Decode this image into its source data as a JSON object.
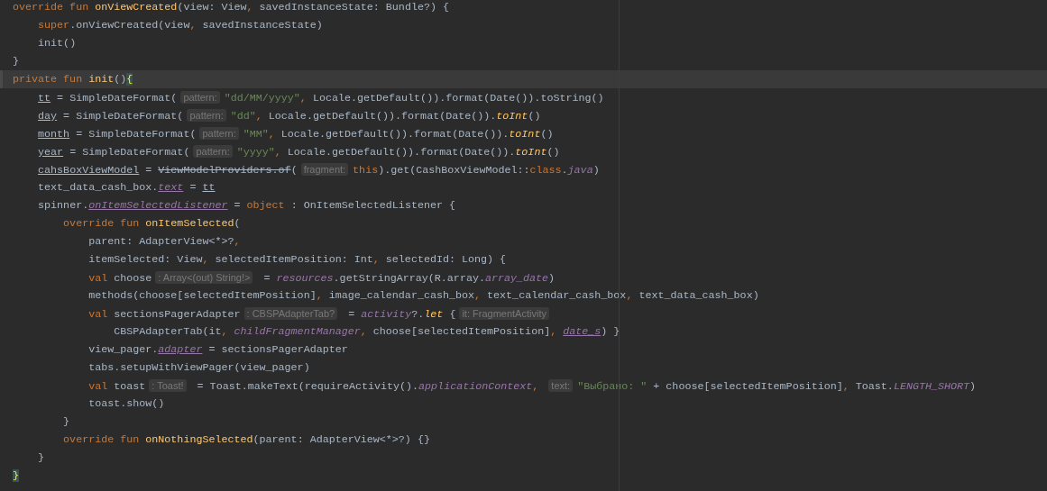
{
  "editor": {
    "lines": [
      {
        "current": false,
        "tokens": [
          {
            "kind": "kw",
            "text": "override fun "
          },
          {
            "kind": "fn",
            "text": "onViewCreated"
          },
          {
            "kind": "plain",
            "text": "(view: View"
          },
          {
            "kind": "op",
            "text": ", "
          },
          {
            "kind": "plain",
            "text": "savedInstanceState: Bundle?) {"
          }
        ]
      },
      {
        "current": false,
        "tokens": [
          {
            "kind": "kw",
            "text": "    super"
          },
          {
            "kind": "plain",
            "text": ".onViewCreated(view"
          },
          {
            "kind": "op",
            "text": ", "
          },
          {
            "kind": "plain",
            "text": "savedInstanceState)"
          }
        ]
      },
      {
        "current": false,
        "tokens": [
          {
            "kind": "plain",
            "text": "    init()"
          }
        ]
      },
      {
        "current": false,
        "tokens": [
          {
            "kind": "plain",
            "text": "}"
          }
        ]
      },
      {
        "current": true,
        "tokens": [
          {
            "kind": "kw",
            "text": "private fun "
          },
          {
            "kind": "fn",
            "text": "init"
          },
          {
            "kind": "plain",
            "text": "()"
          },
          {
            "kind": "match",
            "text": "{"
          }
        ]
      },
      {
        "current": false,
        "tokens": [
          {
            "kind": "var",
            "text": "    tt"
          },
          {
            "kind": "plain",
            "text": " = SimpleDateFormat("
          },
          {
            "kind": "hint",
            "text": "pattern:"
          },
          {
            "kind": "str",
            "text": "\"dd/MM/yyyy\""
          },
          {
            "kind": "op",
            "text": ", "
          },
          {
            "kind": "plain",
            "text": "Locale.getDefault()).format(Date()).toString()"
          }
        ]
      },
      {
        "current": false,
        "tokens": [
          {
            "kind": "var",
            "text": "    day"
          },
          {
            "kind": "plain",
            "text": " = SimpleDateFormat("
          },
          {
            "kind": "hint",
            "text": "pattern:"
          },
          {
            "kind": "str",
            "text": "\"dd\""
          },
          {
            "kind": "op",
            "text": ", "
          },
          {
            "kind": "plain",
            "text": "Locale.getDefault()).format(Date())."
          },
          {
            "kind": "ext",
            "text": "toInt"
          },
          {
            "kind": "plain",
            "text": "()"
          }
        ]
      },
      {
        "current": false,
        "tokens": [
          {
            "kind": "var",
            "text": "    month"
          },
          {
            "kind": "plain",
            "text": " = SimpleDateFormat("
          },
          {
            "kind": "hint",
            "text": "pattern:"
          },
          {
            "kind": "str",
            "text": "\"MM\""
          },
          {
            "kind": "op",
            "text": ", "
          },
          {
            "kind": "plain",
            "text": "Locale.getDefault()).format(Date())."
          },
          {
            "kind": "ext",
            "text": "toInt"
          },
          {
            "kind": "plain",
            "text": "()"
          }
        ]
      },
      {
        "current": false,
        "tokens": [
          {
            "kind": "var",
            "text": "    year"
          },
          {
            "kind": "plain",
            "text": " = SimpleDateFormat("
          },
          {
            "kind": "hint",
            "text": "pattern:"
          },
          {
            "kind": "str",
            "text": "\"yyyy\""
          },
          {
            "kind": "op",
            "text": ", "
          },
          {
            "kind": "plain",
            "text": "Locale.getDefault()).format(Date())."
          },
          {
            "kind": "ext",
            "text": "toInt"
          },
          {
            "kind": "plain",
            "text": "()"
          }
        ]
      },
      {
        "current": false,
        "tokens": [
          {
            "kind": "var",
            "text": "    cahsBoxViewModel"
          },
          {
            "kind": "plain",
            "text": " = "
          },
          {
            "kind": "deprecated",
            "text": "ViewModelProviders.of"
          },
          {
            "kind": "plain",
            "text": "("
          },
          {
            "kind": "hint",
            "text": "fragment:"
          },
          {
            "kind": "kw",
            "text": "this"
          },
          {
            "kind": "plain",
            "text": ").get(CashBoxViewModel::"
          },
          {
            "kind": "kw",
            "text": "class"
          },
          {
            "kind": "plain",
            "text": "."
          },
          {
            "kind": "const",
            "text": "java"
          },
          {
            "kind": "plain",
            "text": ")"
          }
        ]
      },
      {
        "current": false,
        "tokens": [
          {
            "kind": "plain",
            "text": "    text_data_cash_box."
          },
          {
            "kind": "field",
            "text": "text"
          },
          {
            "kind": "plain",
            "text": " = "
          },
          {
            "kind": "var",
            "text": "tt"
          }
        ]
      },
      {
        "current": false,
        "tokens": [
          {
            "kind": "plain",
            "text": "    spinner."
          },
          {
            "kind": "field",
            "text": "onItemSelectedListener"
          },
          {
            "kind": "plain",
            "text": " = "
          },
          {
            "kind": "kw",
            "text": "object"
          },
          {
            "kind": "plain",
            "text": " : OnItemSelectedListener {"
          }
        ]
      },
      {
        "current": false,
        "tokens": [
          {
            "kind": "kw",
            "text": "        override fun "
          },
          {
            "kind": "fn",
            "text": "onItemSelected"
          },
          {
            "kind": "plain",
            "text": "("
          }
        ]
      },
      {
        "current": false,
        "tokens": [
          {
            "kind": "plain",
            "text": "            parent: AdapterView<*>?"
          },
          {
            "kind": "op",
            "text": ","
          }
        ]
      },
      {
        "current": false,
        "tokens": [
          {
            "kind": "plain",
            "text": "            itemSelected: View"
          },
          {
            "kind": "op",
            "text": ", "
          },
          {
            "kind": "plain",
            "text": "selectedItemPosition: Int"
          },
          {
            "kind": "op",
            "text": ", "
          },
          {
            "kind": "plain",
            "text": "selectedId: Long) {"
          }
        ]
      },
      {
        "current": false,
        "tokens": [
          {
            "kind": "kw",
            "text": "            val "
          },
          {
            "kind": "plain",
            "text": "choose"
          },
          {
            "kind": "hint",
            "text": ": Array<(out) String!>"
          },
          {
            "kind": "plain",
            "text": " = "
          },
          {
            "kind": "const",
            "text": "resources"
          },
          {
            "kind": "plain",
            "text": ".getStringArray(R.array."
          },
          {
            "kind": "const",
            "text": "array_date"
          },
          {
            "kind": "plain",
            "text": ")"
          }
        ]
      },
      {
        "current": false,
        "tokens": [
          {
            "kind": "plain",
            "text": "            methods(choose[selectedItemPosition]"
          },
          {
            "kind": "op",
            "text": ", "
          },
          {
            "kind": "plain",
            "text": "image_calendar_cash_box"
          },
          {
            "kind": "op",
            "text": ", "
          },
          {
            "kind": "plain",
            "text": "text_calendar_cash_box"
          },
          {
            "kind": "op",
            "text": ", "
          },
          {
            "kind": "plain",
            "text": "text_data_cash_box)"
          }
        ]
      },
      {
        "current": false,
        "tokens": [
          {
            "kind": "kw",
            "text": "            val "
          },
          {
            "kind": "plain",
            "text": "sectionsPagerAdapter"
          },
          {
            "kind": "hint",
            "text": ": CBSPAdapterTab?"
          },
          {
            "kind": "plain",
            "text": " = "
          },
          {
            "kind": "const",
            "text": "activity"
          },
          {
            "kind": "plain",
            "text": "?."
          },
          {
            "kind": "ext",
            "text": "let"
          },
          {
            "kind": "plain",
            "text": " {"
          },
          {
            "kind": "hint",
            "text": "it: FragmentActivity"
          }
        ]
      },
      {
        "current": false,
        "tokens": [
          {
            "kind": "plain",
            "text": "                CBSPAdapterTab(it"
          },
          {
            "kind": "op",
            "text": ", "
          },
          {
            "kind": "const",
            "text": "childFragmentManager"
          },
          {
            "kind": "op",
            "text": ", "
          },
          {
            "kind": "plain",
            "text": "choose[selectedItemPosition]"
          },
          {
            "kind": "op",
            "text": ", "
          },
          {
            "kind": "field",
            "text": "date_s"
          },
          {
            "kind": "plain",
            "text": ") }"
          }
        ]
      },
      {
        "current": false,
        "tokens": [
          {
            "kind": "plain",
            "text": "            view_pager."
          },
          {
            "kind": "field",
            "text": "adapter"
          },
          {
            "kind": "plain",
            "text": " = sectionsPagerAdapter"
          }
        ]
      },
      {
        "current": false,
        "tokens": [
          {
            "kind": "plain",
            "text": "            tabs.setupWithViewPager(view_pager)"
          }
        ]
      },
      {
        "current": false,
        "tokens": [
          {
            "kind": "kw",
            "text": "            val "
          },
          {
            "kind": "plain",
            "text": "toast"
          },
          {
            "kind": "hint",
            "text": ": Toast!"
          },
          {
            "kind": "plain",
            "text": " = Toast.makeText(requireActivity()."
          },
          {
            "kind": "const",
            "text": "applicationContext"
          },
          {
            "kind": "op",
            "text": ", "
          },
          {
            "kind": "hint",
            "text": "text:"
          },
          {
            "kind": "str",
            "text": "\"Выбрано: \""
          },
          {
            "kind": "plain",
            "text": " + choose[selectedItemPosition]"
          },
          {
            "kind": "op",
            "text": ", "
          },
          {
            "kind": "plain",
            "text": "Toast."
          },
          {
            "kind": "const",
            "text": "LENGTH_SHORT"
          },
          {
            "kind": "plain",
            "text": ")"
          }
        ]
      },
      {
        "current": false,
        "tokens": [
          {
            "kind": "plain",
            "text": "            toast.show()"
          }
        ]
      },
      {
        "current": false,
        "tokens": [
          {
            "kind": "plain",
            "text": "        }"
          }
        ]
      },
      {
        "current": false,
        "tokens": [
          {
            "kind": "kw",
            "text": "        override fun "
          },
          {
            "kind": "fn",
            "text": "onNothingSelected"
          },
          {
            "kind": "plain",
            "text": "(parent: AdapterView<*>?) {}"
          }
        ]
      },
      {
        "current": false,
        "tokens": [
          {
            "kind": "plain",
            "text": "    }"
          }
        ]
      },
      {
        "current": false,
        "tokens": [
          {
            "kind": "match",
            "text": "}"
          }
        ]
      }
    ]
  }
}
